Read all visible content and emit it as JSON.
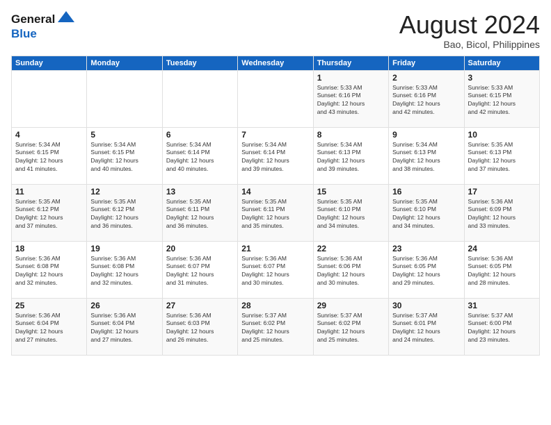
{
  "logo": {
    "line1": "General",
    "line2": "Blue"
  },
  "title": "August 2024",
  "subtitle": "Bao, Bicol, Philippines",
  "days_of_week": [
    "Sunday",
    "Monday",
    "Tuesday",
    "Wednesday",
    "Thursday",
    "Friday",
    "Saturday"
  ],
  "weeks": [
    [
      {
        "num": "",
        "info": ""
      },
      {
        "num": "",
        "info": ""
      },
      {
        "num": "",
        "info": ""
      },
      {
        "num": "",
        "info": ""
      },
      {
        "num": "1",
        "info": "Sunrise: 5:33 AM\nSunset: 6:16 PM\nDaylight: 12 hours\nand 43 minutes."
      },
      {
        "num": "2",
        "info": "Sunrise: 5:33 AM\nSunset: 6:16 PM\nDaylight: 12 hours\nand 42 minutes."
      },
      {
        "num": "3",
        "info": "Sunrise: 5:33 AM\nSunset: 6:15 PM\nDaylight: 12 hours\nand 42 minutes."
      }
    ],
    [
      {
        "num": "4",
        "info": "Sunrise: 5:34 AM\nSunset: 6:15 PM\nDaylight: 12 hours\nand 41 minutes."
      },
      {
        "num": "5",
        "info": "Sunrise: 5:34 AM\nSunset: 6:15 PM\nDaylight: 12 hours\nand 40 minutes."
      },
      {
        "num": "6",
        "info": "Sunrise: 5:34 AM\nSunset: 6:14 PM\nDaylight: 12 hours\nand 40 minutes."
      },
      {
        "num": "7",
        "info": "Sunrise: 5:34 AM\nSunset: 6:14 PM\nDaylight: 12 hours\nand 39 minutes."
      },
      {
        "num": "8",
        "info": "Sunrise: 5:34 AM\nSunset: 6:13 PM\nDaylight: 12 hours\nand 39 minutes."
      },
      {
        "num": "9",
        "info": "Sunrise: 5:34 AM\nSunset: 6:13 PM\nDaylight: 12 hours\nand 38 minutes."
      },
      {
        "num": "10",
        "info": "Sunrise: 5:35 AM\nSunset: 6:13 PM\nDaylight: 12 hours\nand 37 minutes."
      }
    ],
    [
      {
        "num": "11",
        "info": "Sunrise: 5:35 AM\nSunset: 6:12 PM\nDaylight: 12 hours\nand 37 minutes."
      },
      {
        "num": "12",
        "info": "Sunrise: 5:35 AM\nSunset: 6:12 PM\nDaylight: 12 hours\nand 36 minutes."
      },
      {
        "num": "13",
        "info": "Sunrise: 5:35 AM\nSunset: 6:11 PM\nDaylight: 12 hours\nand 36 minutes."
      },
      {
        "num": "14",
        "info": "Sunrise: 5:35 AM\nSunset: 6:11 PM\nDaylight: 12 hours\nand 35 minutes."
      },
      {
        "num": "15",
        "info": "Sunrise: 5:35 AM\nSunset: 6:10 PM\nDaylight: 12 hours\nand 34 minutes."
      },
      {
        "num": "16",
        "info": "Sunrise: 5:35 AM\nSunset: 6:10 PM\nDaylight: 12 hours\nand 34 minutes."
      },
      {
        "num": "17",
        "info": "Sunrise: 5:36 AM\nSunset: 6:09 PM\nDaylight: 12 hours\nand 33 minutes."
      }
    ],
    [
      {
        "num": "18",
        "info": "Sunrise: 5:36 AM\nSunset: 6:08 PM\nDaylight: 12 hours\nand 32 minutes."
      },
      {
        "num": "19",
        "info": "Sunrise: 5:36 AM\nSunset: 6:08 PM\nDaylight: 12 hours\nand 32 minutes."
      },
      {
        "num": "20",
        "info": "Sunrise: 5:36 AM\nSunset: 6:07 PM\nDaylight: 12 hours\nand 31 minutes."
      },
      {
        "num": "21",
        "info": "Sunrise: 5:36 AM\nSunset: 6:07 PM\nDaylight: 12 hours\nand 30 minutes."
      },
      {
        "num": "22",
        "info": "Sunrise: 5:36 AM\nSunset: 6:06 PM\nDaylight: 12 hours\nand 30 minutes."
      },
      {
        "num": "23",
        "info": "Sunrise: 5:36 AM\nSunset: 6:05 PM\nDaylight: 12 hours\nand 29 minutes."
      },
      {
        "num": "24",
        "info": "Sunrise: 5:36 AM\nSunset: 6:05 PM\nDaylight: 12 hours\nand 28 minutes."
      }
    ],
    [
      {
        "num": "25",
        "info": "Sunrise: 5:36 AM\nSunset: 6:04 PM\nDaylight: 12 hours\nand 27 minutes."
      },
      {
        "num": "26",
        "info": "Sunrise: 5:36 AM\nSunset: 6:04 PM\nDaylight: 12 hours\nand 27 minutes."
      },
      {
        "num": "27",
        "info": "Sunrise: 5:36 AM\nSunset: 6:03 PM\nDaylight: 12 hours\nand 26 minutes."
      },
      {
        "num": "28",
        "info": "Sunrise: 5:37 AM\nSunset: 6:02 PM\nDaylight: 12 hours\nand 25 minutes."
      },
      {
        "num": "29",
        "info": "Sunrise: 5:37 AM\nSunset: 6:02 PM\nDaylight: 12 hours\nand 25 minutes."
      },
      {
        "num": "30",
        "info": "Sunrise: 5:37 AM\nSunset: 6:01 PM\nDaylight: 12 hours\nand 24 minutes."
      },
      {
        "num": "31",
        "info": "Sunrise: 5:37 AM\nSunset: 6:00 PM\nDaylight: 12 hours\nand 23 minutes."
      }
    ]
  ]
}
